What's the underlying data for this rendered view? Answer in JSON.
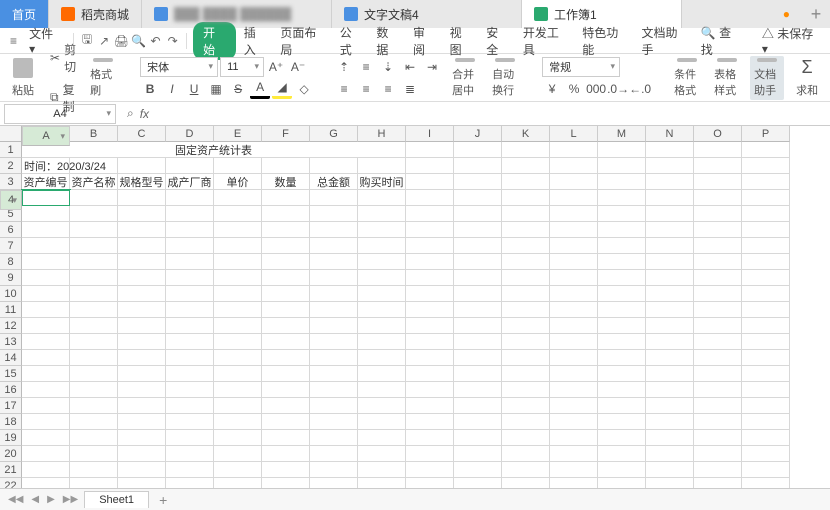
{
  "tabs": {
    "home": "首页",
    "t1": "稻壳商城",
    "t2_blurred": "███ ████ ██████",
    "t3": "文字文稿4",
    "t4": "工作簿1"
  },
  "menubar": {
    "file": "文件",
    "items": [
      "开始",
      "插入",
      "页面布局",
      "公式",
      "数据",
      "审阅",
      "视图",
      "安全",
      "开发工具",
      "特色功能",
      "文档助手"
    ],
    "find": "查找",
    "unsaved": "未保存"
  },
  "ribbon": {
    "paste": "粘贴",
    "cut": "剪切",
    "copy": "复制",
    "format_painter": "格式刷",
    "font": "宋体",
    "font_size": "11",
    "merge_center": "合并居中",
    "wrap": "自动换行",
    "number_format": "常规",
    "cond_format": "条件格式",
    "table_style": "表格样式",
    "doc_helper": "文档助手",
    "sum": "求和"
  },
  "fx": {
    "cellref": "A4",
    "formula": ""
  },
  "grid": {
    "cols": [
      "A",
      "B",
      "C",
      "D",
      "E",
      "F",
      "G",
      "H",
      "I",
      "J",
      "K",
      "L",
      "M",
      "N",
      "O",
      "P"
    ],
    "rowcount": 23,
    "selected": {
      "col": "A",
      "row": 4
    },
    "title_row": 1,
    "title_text": "固定资产统计表",
    "r2_a": "时间：2020/3/24",
    "headers_row": 3,
    "headers": [
      "资产编号",
      "资产名称",
      "规格型号",
      "成产厂商",
      "单价",
      "数量",
      "总金额",
      "购买时间"
    ]
  },
  "sheets": {
    "active": "Sheet1"
  }
}
